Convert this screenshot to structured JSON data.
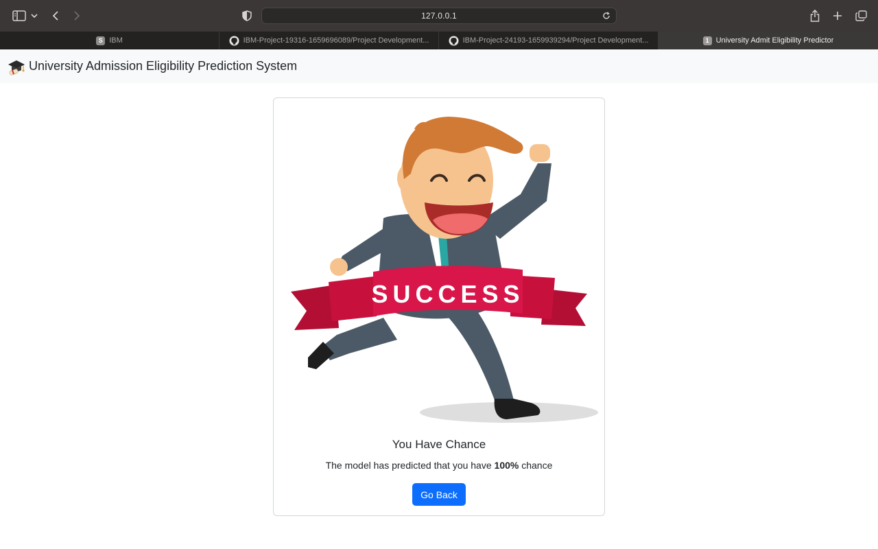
{
  "browser": {
    "url": "127.0.0.1",
    "tabs": [
      {
        "title": "IBM",
        "favicon": "S",
        "active": false
      },
      {
        "title": "IBM-Project-19316-1659696089/Project Development...",
        "favicon": "github-icon",
        "active": false
      },
      {
        "title": "IBM-Project-24193-1659939294/Project Development...",
        "favicon": "github-icon",
        "active": false
      },
      {
        "title": "University Admit Eligibility Predictor",
        "favicon": "1",
        "active": true
      }
    ]
  },
  "navbar": {
    "brand": "University Admission Eligibility Prediction System",
    "brand_icon": "graduation-cap-icon"
  },
  "card": {
    "banner_text": "SUCCESS",
    "title": "You Have Chance",
    "text_prefix": "The model has predicted that you have ",
    "chance": "100%",
    "text_suffix": " chance",
    "button": "Go Back"
  },
  "colors": {
    "primary": "#0d6efd",
    "banner": "#c8103c",
    "navbar_bg": "#f8f9fa"
  }
}
